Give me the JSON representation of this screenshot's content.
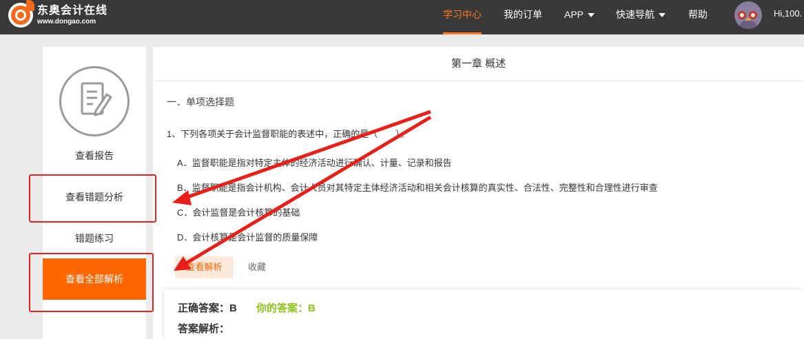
{
  "header": {
    "logo_cn": "东奥会计在线",
    "logo_url": "www.dongao.com",
    "nav": [
      {
        "label": "学习中心",
        "active": true
      },
      {
        "label": "我的订单"
      },
      {
        "label": "APP",
        "dropdown": true
      },
      {
        "label": "快速导航",
        "dropdown": true
      },
      {
        "label": "帮助"
      }
    ],
    "greeting": "Hi,100."
  },
  "sidebar": {
    "items": [
      "查看报告",
      "查看错题分析",
      "错题练习"
    ],
    "primary_button": "查看全部解析"
  },
  "main": {
    "chapter_title": "第一章 概述",
    "section_title": "一．单项选择题",
    "question": "1、下列各项关于会计监督职能的表述中，正确的是（　　）。",
    "options": [
      "A．监督职能是指对特定主体的经济活动进行确认、计量、记录和报告",
      "B．监督职能是指会计机构、会计人员对其特定主体经济活动和相关会计核算的真实性、合法性、完整性和合理性进行审查",
      "C．会计监督是会计核算的基础",
      "D．会计核算是会计监督的质量保障"
    ],
    "view_explanation": "查看解析",
    "favorite": "收藏",
    "answer": {
      "correct_label": "正确答案：B",
      "yours_label": "你的答案：B",
      "explanation_label": "答案解析："
    }
  },
  "colors": {
    "accent": "#ff6600",
    "topbar": "#393939",
    "annotation_red": "#e8201a",
    "your_answer_green": "#8cc21a"
  }
}
